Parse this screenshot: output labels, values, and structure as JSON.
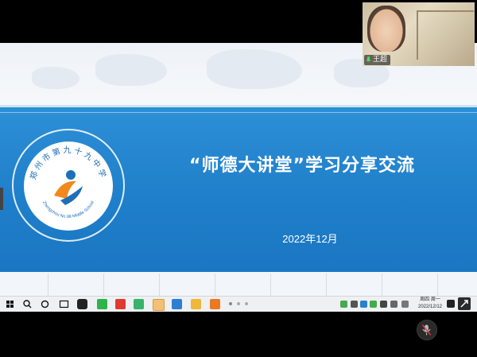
{
  "slide": {
    "title": "“师德大讲堂”学习分享交流",
    "date": "2022年12月",
    "logo_text": "郑州市第九十九中学",
    "logo_subtext": "Zhengzhou No.99 Middle School"
  },
  "video_tile": {
    "participant_name": "王超"
  },
  "taskbar": {
    "clock_time": "周四 周一",
    "clock_date": "2022/12/12"
  },
  "colors": {
    "band_blue": "#1f7fca",
    "slide_bg": "#f3f6fa",
    "taskbar_bg": "#eef0f3"
  }
}
